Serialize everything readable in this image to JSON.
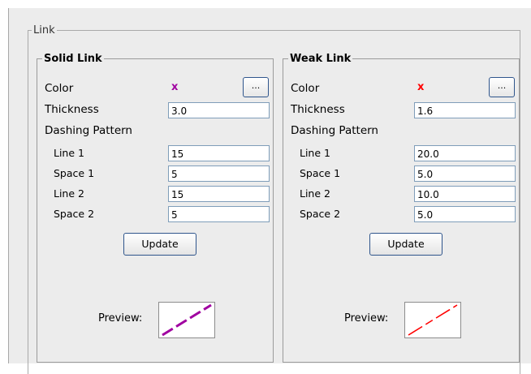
{
  "section_title": "Link",
  "solid": {
    "title": "Solid Link",
    "color_label": "Color",
    "color_mark": "x",
    "color_hex": "#a000a0",
    "choose_label": "...",
    "thickness_label": "Thickness",
    "thickness": "3.0",
    "dash_label": "Dashing Pattern",
    "line1_label": "Line 1",
    "line1": "15",
    "space1_label": "Space 1",
    "space1": "5",
    "line2_label": "Line 2",
    "line2": "15",
    "space2_label": "Space 2",
    "space2": "5",
    "update_label": "Update",
    "preview_label": "Preview:"
  },
  "weak": {
    "title": "Weak Link",
    "color_label": "Color",
    "color_mark": "x",
    "color_hex": "#ff0000",
    "choose_label": "...",
    "thickness_label": "Thickness",
    "thickness": "1.6",
    "dash_label": "Dashing Pattern",
    "line1_label": "Line 1",
    "line1": "20.0",
    "space1_label": "Space 1",
    "space1": "5.0",
    "line2_label": "Line 2",
    "line2": "10.0",
    "space2_label": "Space 2",
    "space2": "5.0",
    "update_label": "Update",
    "preview_label": "Preview:"
  }
}
